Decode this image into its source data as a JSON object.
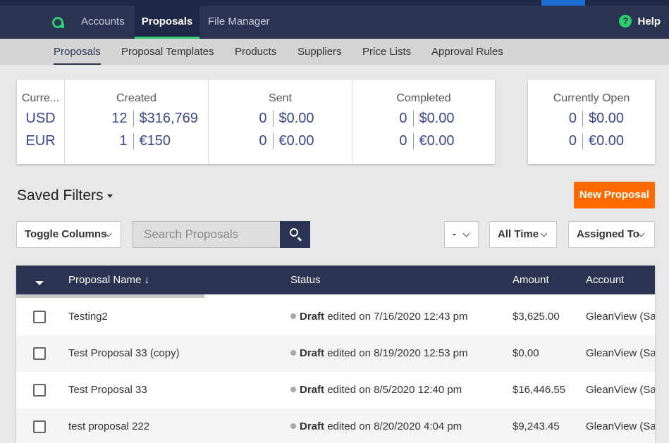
{
  "topnav": {
    "items": [
      {
        "label": "Accounts"
      },
      {
        "label": "Proposals",
        "active": true
      },
      {
        "label": "File Manager"
      }
    ],
    "help_label": "Help"
  },
  "subnav": {
    "items": [
      {
        "label": "Proposals",
        "active": true
      },
      {
        "label": "Proposal Templates"
      },
      {
        "label": "Products"
      },
      {
        "label": "Suppliers"
      },
      {
        "label": "Price Lists"
      },
      {
        "label": "Approval Rules"
      }
    ]
  },
  "summary": {
    "currency_header": "Curre...",
    "currencies": [
      "USD",
      "EUR"
    ],
    "columns": [
      {
        "header": "Created",
        "rows": [
          {
            "count": "12",
            "amount": "$316,769"
          },
          {
            "count": "1",
            "amount": "€150"
          }
        ]
      },
      {
        "header": "Sent",
        "rows": [
          {
            "count": "0",
            "amount": "$0.00"
          },
          {
            "count": "0",
            "amount": "€0.00"
          }
        ]
      },
      {
        "header": "Completed",
        "rows": [
          {
            "count": "0",
            "amount": "$0.00"
          },
          {
            "count": "0",
            "amount": "€0.00"
          }
        ]
      }
    ],
    "open": {
      "header": "Currently Open",
      "rows": [
        {
          "count": "0",
          "amount": "$0.00"
        },
        {
          "count": "0",
          "amount": "€0.00"
        }
      ]
    }
  },
  "filters": {
    "saved_label": "Saved Filters",
    "new_button": "New Proposal",
    "toggle_columns": "Toggle Columns",
    "search_placeholder": "Search Proposals",
    "dash_select": "-",
    "time_select": "All Time",
    "assigned_select": "Assigned To"
  },
  "table": {
    "columns": [
      "Proposal Name ↓",
      "Status",
      "Amount",
      "Account"
    ],
    "rows": [
      {
        "name": "Testing2",
        "status": "Draft",
        "status_detail": "edited on 7/16/2020 12:43 pm",
        "amount": "$3,625.00",
        "account": "GleanView (Sar"
      },
      {
        "name": "Test Proposal 33 (copy)",
        "status": "Draft",
        "status_detail": "edited on 8/19/2020 12:53 pm",
        "amount": "$0.00",
        "account": "GleanView (Sar"
      },
      {
        "name": "Test Proposal 33",
        "status": "Draft",
        "status_detail": "edited on 8/5/2020 12:40 pm",
        "amount": "$16,446.55",
        "account": "GleanView (Sar"
      },
      {
        "name": "test proposal 222",
        "status": "Draft",
        "status_detail": "edited on 8/20/2020 4:04 pm",
        "amount": "$9,243.45",
        "account": "GleanView (Sar"
      }
    ]
  },
  "colors": {
    "nav": "#2b3352",
    "accent_green": "#2ecc71",
    "orange": "#ff6a00",
    "amount_blue": "#3a4790"
  }
}
